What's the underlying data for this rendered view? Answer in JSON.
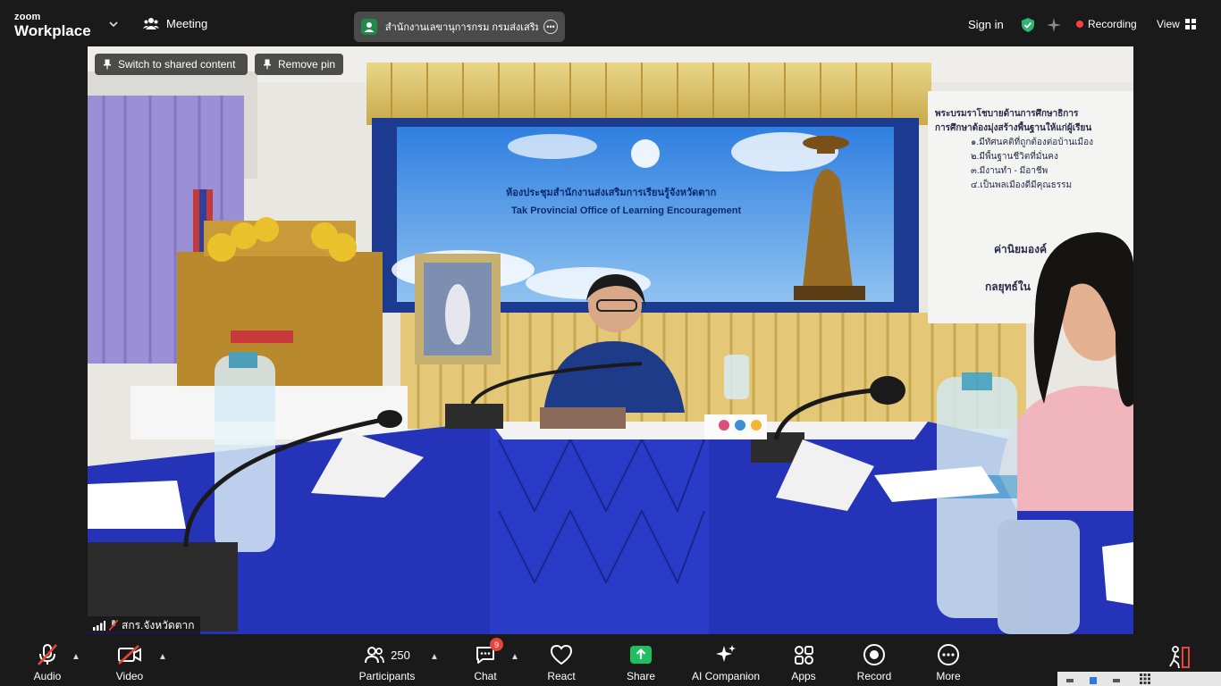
{
  "app": {
    "logo_small": "zoom",
    "logo_large": "Workplace",
    "meeting_label": "Meeting",
    "meeting_title": "สำนักงานเลขานุการกรม กรมส่งเสริมการ",
    "sign_in": "Sign in",
    "recording_label": "Recording",
    "view_label": "View"
  },
  "pins": {
    "switch_label": "Switch to shared content",
    "remove_label": "Remove pin"
  },
  "participant": {
    "name": "สกร.จังหวัดตาก"
  },
  "scene": {
    "banner_thai": "ห้องประชุมสำนักงานส่งเสริมการเรียนรู้จังหวัดตาก",
    "banner_en": "Tak Provincial Office of Learning Encouragement",
    "board_lines": [
      "พระบรมราโชบายด้านการศึกษาธิการ",
      "การศึกษาต้องมุ่งสร้างพื้นฐานให้แก่ผู้เรียน",
      "๑.มีทัศนคติที่ถูกต้องต่อบ้านเมือง",
      "๒.มีพื้นฐานชีวิตที่มั่นคง",
      "๓.มีงานทำ - มีอาชีพ",
      "๔.เป็นพลเมืองดีมีคุณธรรม"
    ],
    "board_lower": [
      "ค่านิยมองค์",
      "กลยุทธ์ใน"
    ]
  },
  "toolbar": {
    "audio": "Audio",
    "video": "Video",
    "participants": "Participants",
    "participants_count": "250",
    "chat": "Chat",
    "chat_badge": "9",
    "react": "React",
    "share": "Share",
    "ai": "AI Companion",
    "apps": "Apps",
    "record": "Record",
    "more": "More"
  },
  "colors": {
    "share_green": "#1fbf5f",
    "recording_red": "#ff3b3b",
    "muted_red": "#e8443a",
    "shield_green": "#2bb673"
  }
}
